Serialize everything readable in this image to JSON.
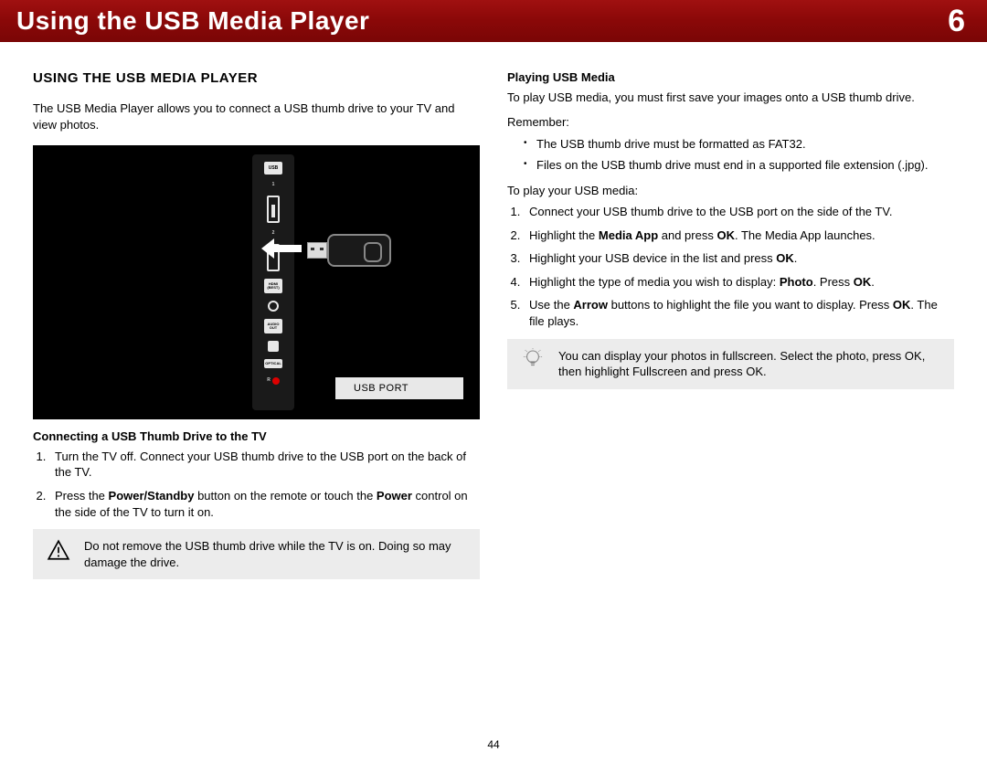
{
  "header": {
    "title": "Using the USB Media Player",
    "chapter": "6"
  },
  "left": {
    "section_heading": "USING THE USB MEDIA PLAYER",
    "intro": "The USB Media Player allows you to connect a USB thumb drive to your TV and view photos.",
    "illustration": {
      "labels": {
        "usb": "USB",
        "port1": "1",
        "port2": "2",
        "hdmi": "HDMI",
        "hdmi_best": "(BEST)",
        "audio": "AUDIO",
        "audio_out": "OUT",
        "optical": "OPTICAL",
        "r": "R"
      },
      "caption": "USB PORT"
    },
    "connect_subhead": "Connecting a USB Thumb Drive to the TV",
    "connect_steps": [
      "Turn the TV off. Connect your USB thumb drive to the USB port on the back of the TV.",
      "Press the <b>Power/Standby</b> button on the remote or touch the <b>Power</b> control on the side of the TV to turn it on."
    ],
    "warning": "Do not remove the USB thumb drive while the TV is on. Doing so may damage the drive."
  },
  "right": {
    "play_subhead": "Playing USB Media",
    "play_intro": "To play USB media, you must first save your images onto a USB thumb drive.",
    "remember_label": "Remember:",
    "remember_items": [
      "The USB thumb drive must be formatted as FAT32.",
      "Files on the USB thumb drive must end in a supported file extension (.jpg)."
    ],
    "toplay_label": "To play your USB media:",
    "play_steps": [
      "Connect your USB thumb drive to the USB port on the side of the TV.",
      "Highlight the <b>Media App</b> and press <b>OK</b>. The Media App launches.",
      "Highlight your USB device in the list and press <b>OK</b>.",
      "Highlight the type of media you wish to display: <b>Photo</b>. Press <b>OK</b>.",
      "Use the <b>Arrow</b> buttons to highlight the file you want to display. Press <b>OK</b>. The file plays."
    ],
    "tip": "You can display your photos in fullscreen. Select the photo, press OK, then highlight Fullscreen and press OK."
  },
  "page_number": "44"
}
